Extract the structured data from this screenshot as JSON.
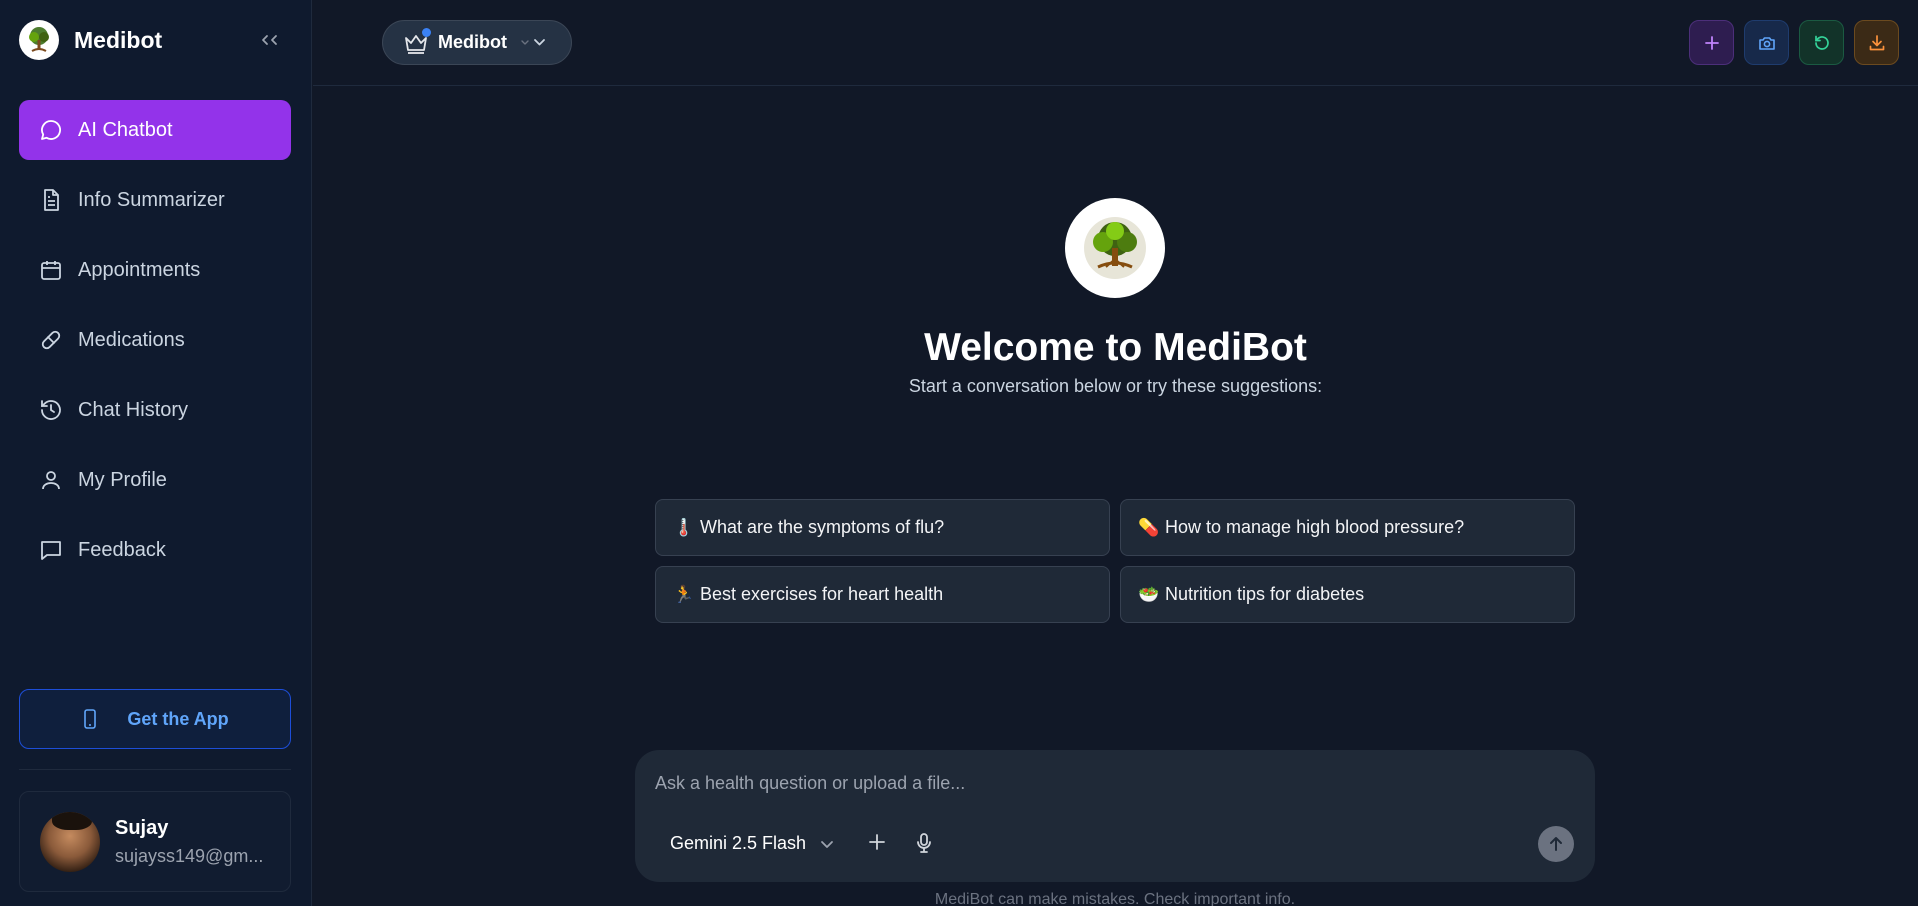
{
  "brand": {
    "name": "Medibot",
    "logo_icon": "tree-logo-icon"
  },
  "sidebar": {
    "items": [
      {
        "label": "AI Chatbot",
        "icon": "chat-bubble-icon",
        "active": true
      },
      {
        "label": "Info Summarizer",
        "icon": "document-icon",
        "active": false
      },
      {
        "label": "Appointments",
        "icon": "calendar-icon",
        "active": false
      },
      {
        "label": "Medications",
        "icon": "pill-icon",
        "active": false
      },
      {
        "label": "Chat History",
        "icon": "history-icon",
        "active": false
      },
      {
        "label": "My Profile",
        "icon": "user-icon",
        "active": false
      },
      {
        "label": "Feedback",
        "icon": "feedback-icon",
        "active": false
      }
    ],
    "get_app_label": "Get the App",
    "user": {
      "name": "Sujay",
      "email": "sujayss149@gm..."
    }
  },
  "header": {
    "model_pill_label": "Medibot"
  },
  "main": {
    "welcome_title": "Welcome to MediBot",
    "subtitle": "Start a conversation below or try these suggestions:",
    "suggestions": [
      {
        "emoji": "🌡️",
        "text": "What are the symptoms of flu?"
      },
      {
        "emoji": "💊",
        "text": "How to manage high blood pressure?"
      },
      {
        "emoji": "🏃",
        "text": "Best exercises for heart health"
      },
      {
        "emoji": "🥗",
        "text": "Nutrition tips for diabetes"
      }
    ]
  },
  "composer": {
    "placeholder": "Ask a health question or upload a file...",
    "model": "Gemini 2.5 Flash"
  },
  "disclaimer": "MediBot can make mistakes. Check important info.",
  "colors": {
    "accent": "#9333ea",
    "background": "#111827",
    "sidebar": "#0f1a2e",
    "link_blue": "#60a5fa"
  }
}
